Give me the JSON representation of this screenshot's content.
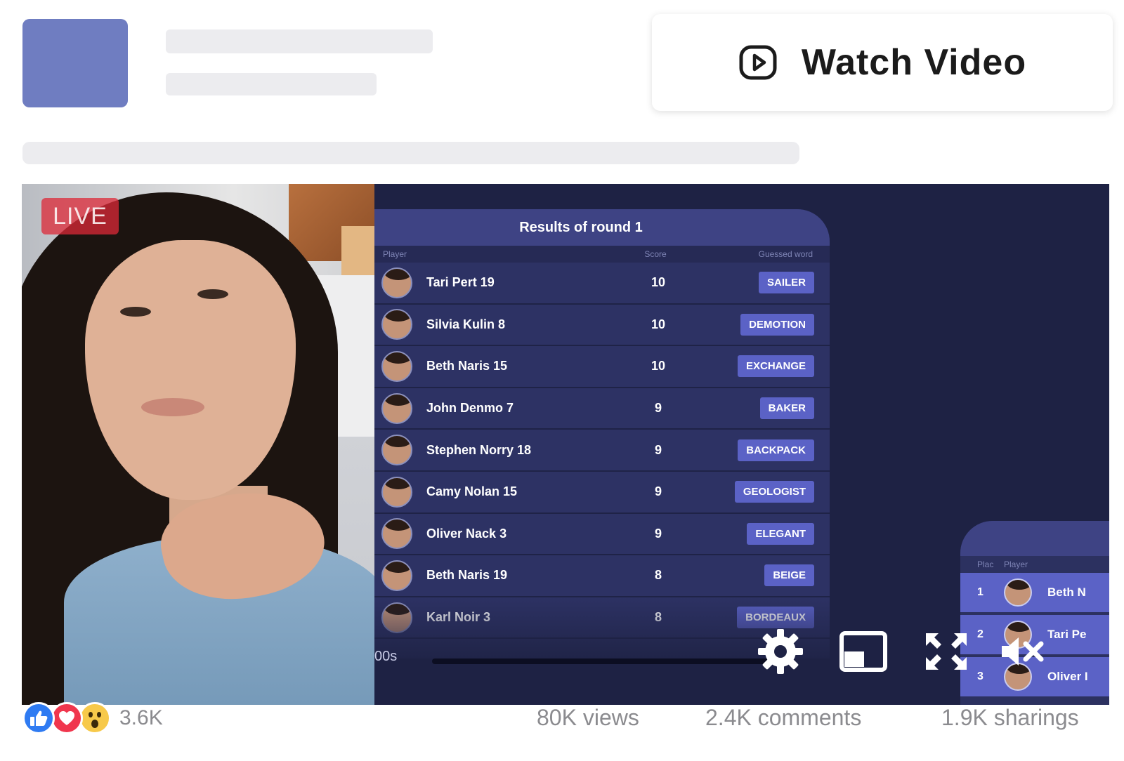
{
  "header": {
    "watch_button_label": "Watch Video"
  },
  "video": {
    "live_label": "LIVE",
    "results": {
      "title": "Results of round 1",
      "col_player": "Player",
      "col_score": "Score",
      "col_word": "Guessed word",
      "rows": [
        {
          "name": "Tari Pert 19",
          "score": "10",
          "word": "SAILER"
        },
        {
          "name": "Silvia Kulin 8",
          "score": "10",
          "word": "DEMOTION"
        },
        {
          "name": "Beth Naris 15",
          "score": "10",
          "word": "EXCHANGE"
        },
        {
          "name": "John Denmo 7",
          "score": "9",
          "word": "BAKER"
        },
        {
          "name": "Stephen Norry 18",
          "score": "9",
          "word": "BACKPACK"
        },
        {
          "name": "Camy Nolan 15",
          "score": "9",
          "word": "GEOLOGIST"
        },
        {
          "name": "Oliver Nack 3",
          "score": "9",
          "word": "ELEGANT"
        },
        {
          "name": "Beth Naris 19",
          "score": "8",
          "word": "BEIGE"
        },
        {
          "name": "Karl Noir 3",
          "score": "8",
          "word": "BORDEAUX"
        }
      ]
    },
    "standings": {
      "col_place": "Plac",
      "col_player": "Player",
      "rows": [
        {
          "place": "1",
          "name": "Beth N"
        },
        {
          "place": "2",
          "name": "Tari Pe"
        },
        {
          "place": "3",
          "name": "Oliver I"
        }
      ]
    },
    "timecode": "00s",
    "icons": {
      "settings": "gear-icon",
      "pip": "picture-in-picture-icon",
      "fullscreen": "fullscreen-icon",
      "mute": "mute-icon"
    }
  },
  "footer": {
    "reaction_count": "3.6K",
    "views": "80K views",
    "comments": "2.4K comments",
    "shares": "1.9K sharings"
  },
  "colors": {
    "accent": "#5b62c6",
    "panel": "#2c3160",
    "video_bg": "#1e2244",
    "placeholder_avatar": "#6f7dc1"
  }
}
